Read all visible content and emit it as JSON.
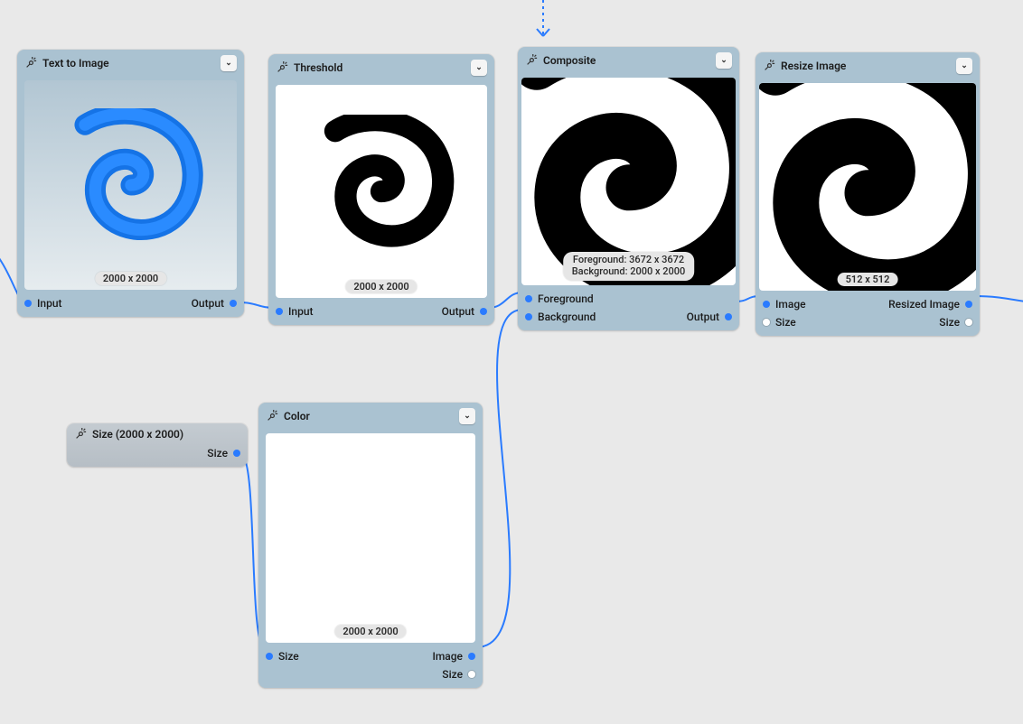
{
  "nodes": {
    "text_to_image": {
      "title": "Text to Image",
      "dims_badge": "2000 x 2000",
      "ports": {
        "input": "Input",
        "output": "Output"
      }
    },
    "threshold": {
      "title": "Threshold",
      "dims_badge": "2000 x 2000",
      "ports": {
        "input": "Input",
        "output": "Output"
      }
    },
    "composite": {
      "title": "Composite",
      "badge_line1": "Foreground: 3672 x 3672",
      "badge_line2": "Background: 2000 x 2000",
      "ports": {
        "foreground": "Foreground",
        "background": "Background",
        "output": "Output"
      }
    },
    "resize": {
      "title": "Resize Image",
      "dims_badge": "512 x 512",
      "ports": {
        "image": "Image",
        "size": "Size",
        "resized_image": "Resized Image",
        "out_size": "Size"
      }
    },
    "size": {
      "title": "Size (2000 x 2000)",
      "ports": {
        "size": "Size"
      }
    },
    "color": {
      "title": "Color",
      "dims_badge": "2000 x 2000",
      "ports": {
        "size": "Size",
        "image": "Image",
        "out_size": "Size"
      }
    }
  },
  "icons": {
    "tools": "tools-icon",
    "chevron_down": "⌄"
  },
  "colors": {
    "node_bg": "#aac2d1",
    "canvas_bg": "#e9e9e9",
    "wire": "#2a7bff",
    "port_image": "#2a7bff",
    "port_size": "#ffffff"
  }
}
